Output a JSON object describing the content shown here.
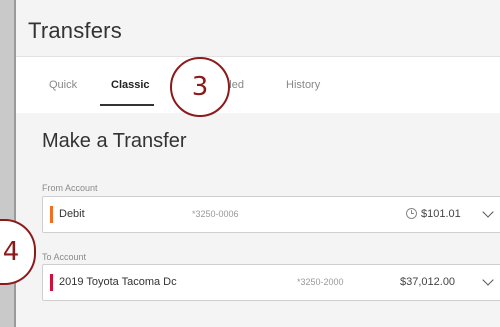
{
  "page": {
    "title": "Transfers"
  },
  "tabs": [
    {
      "label": "Quick"
    },
    {
      "label": "Classic"
    },
    {
      "label": "Scheduled"
    },
    {
      "label": "History"
    }
  ],
  "form": {
    "title": "Make a Transfer",
    "from": {
      "label": "From Account",
      "name": "Debit",
      "number": "*3250-0006",
      "balance": "$101.01",
      "accent_color": "#f26f21"
    },
    "to": {
      "label": "To Account",
      "name": "2019 Toyota Tacoma Dc",
      "number": "*3250-2000",
      "balance": "$37,012.00",
      "accent_color": "#d0103a"
    }
  },
  "callouts": [
    {
      "label": "3"
    },
    {
      "label": "4"
    }
  ]
}
